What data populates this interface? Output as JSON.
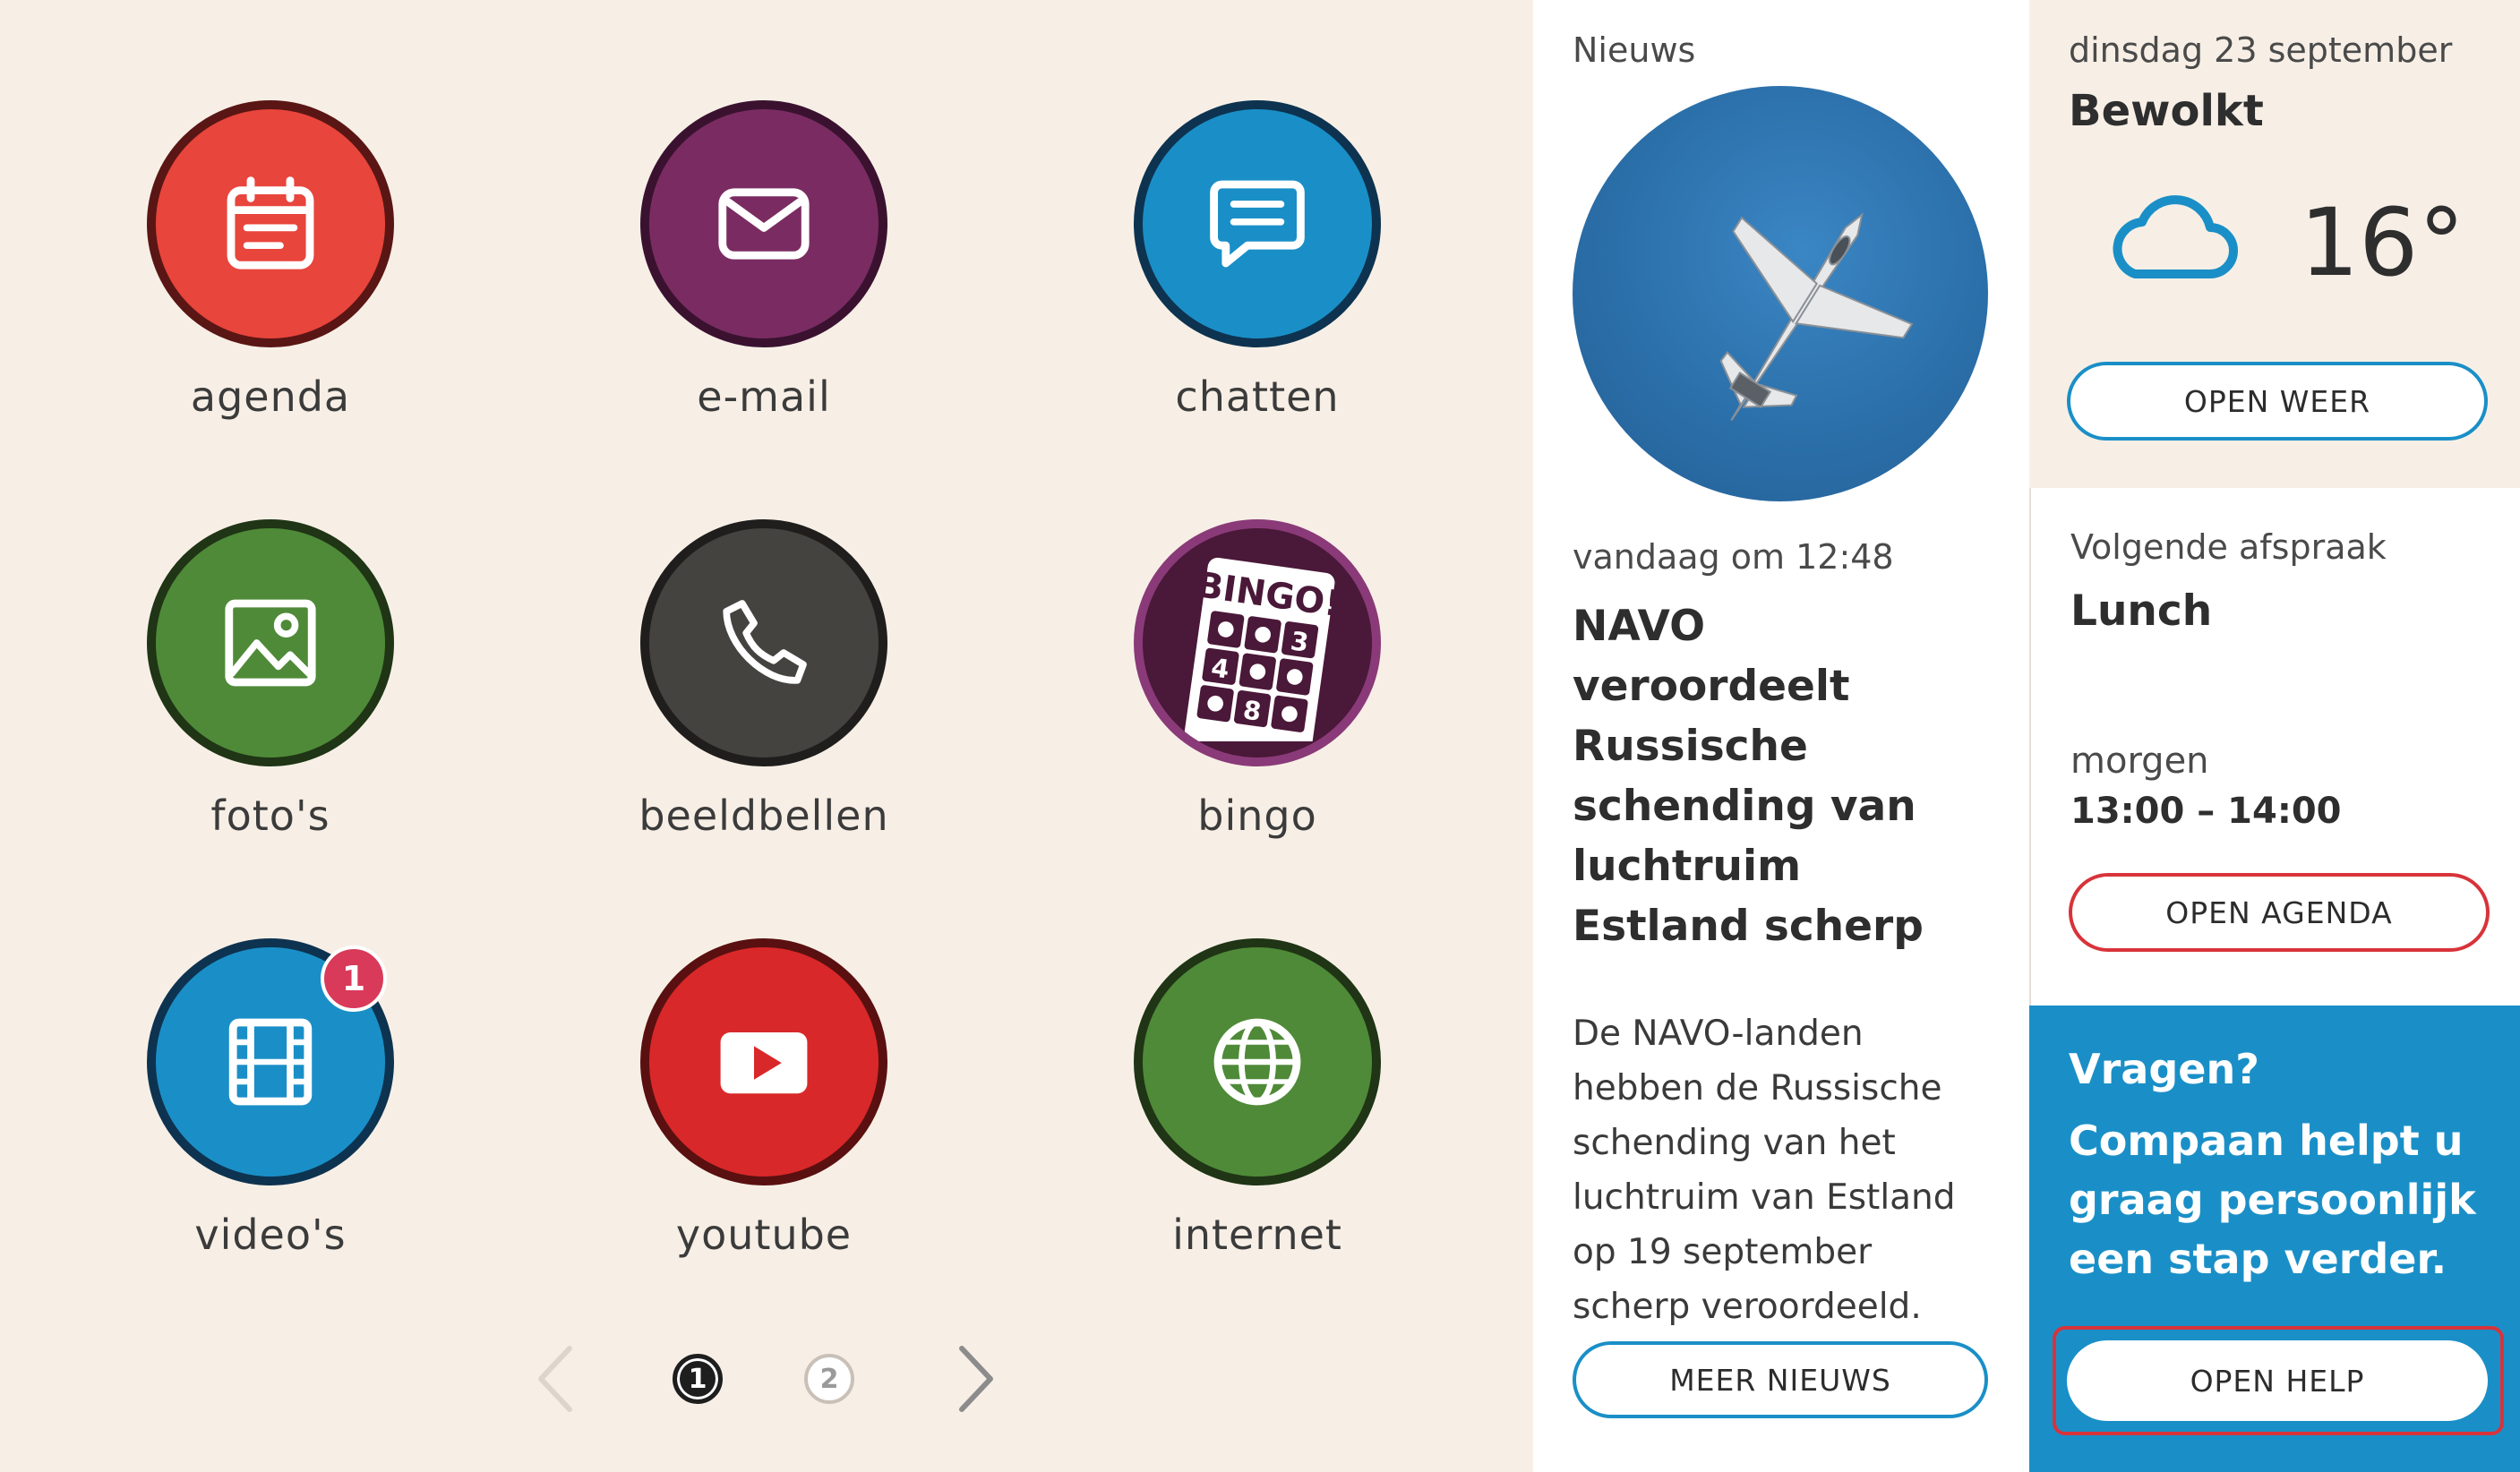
{
  "apps": [
    {
      "label": "agenda",
      "icon": "calendar-icon",
      "color": "#e8453c",
      "border": "#5a1614"
    },
    {
      "label": "e-mail",
      "icon": "envelope-icon",
      "color": "#7a2c62",
      "border": "#3a1230"
    },
    {
      "label": "chatten",
      "icon": "chat-bubble-icon",
      "color": "#1a8fc7",
      "border": "#0d3350"
    },
    {
      "label": "foto's",
      "icon": "image-icon",
      "color": "#4f8a38",
      "border": "#1f3515"
    },
    {
      "label": "beeldbellen",
      "icon": "phone-icon",
      "color": "#454340",
      "border": "#1f1e1c"
    },
    {
      "label": "bingo",
      "icon": "bingo-card-icon",
      "color": "#4a1838",
      "border": "#8a3a78"
    },
    {
      "label": "video's",
      "icon": "film-icon",
      "color": "#1a8fc7",
      "border": "#0d3350",
      "badge": "1"
    },
    {
      "label": "youtube",
      "icon": "play-icon",
      "color": "#d9282a",
      "border": "#5a1010"
    },
    {
      "label": "internet",
      "icon": "globe-icon",
      "color": "#4f8a38",
      "border": "#1f3515"
    }
  ],
  "pager": {
    "page1": "1",
    "page2": "2"
  },
  "news": {
    "section_label": "Nieuws",
    "time": "vandaag om 12:48",
    "headline": "NAVO veroordeelt Russische schending van luchtruim Estland scherp",
    "body": "De NAVO-landen hebben de Russische schending van het luchtruim van Estland op 19 september scherp veroordeeld. Dat staat in een",
    "button": "MEER NIEUWS"
  },
  "weather": {
    "date": "dinsdag 23 september",
    "condition": "Bewolkt",
    "temperature": "16°",
    "icon": "cloud-icon",
    "button": "OPEN WEER"
  },
  "agenda": {
    "label": "Volgende afspraak",
    "title": "Lunch",
    "when": "morgen",
    "time": "13:00 – 14:00",
    "button": "OPEN AGENDA"
  },
  "help": {
    "question": "Vragen?",
    "text": "Compaan helpt u graag persoonlijk een stap verder.",
    "button": "OPEN HELP"
  },
  "colors": {
    "background": "#f7efe6",
    "accent_blue": "#1a8fc7",
    "accent_red": "#d8333a",
    "badge": "#d93a5a"
  }
}
